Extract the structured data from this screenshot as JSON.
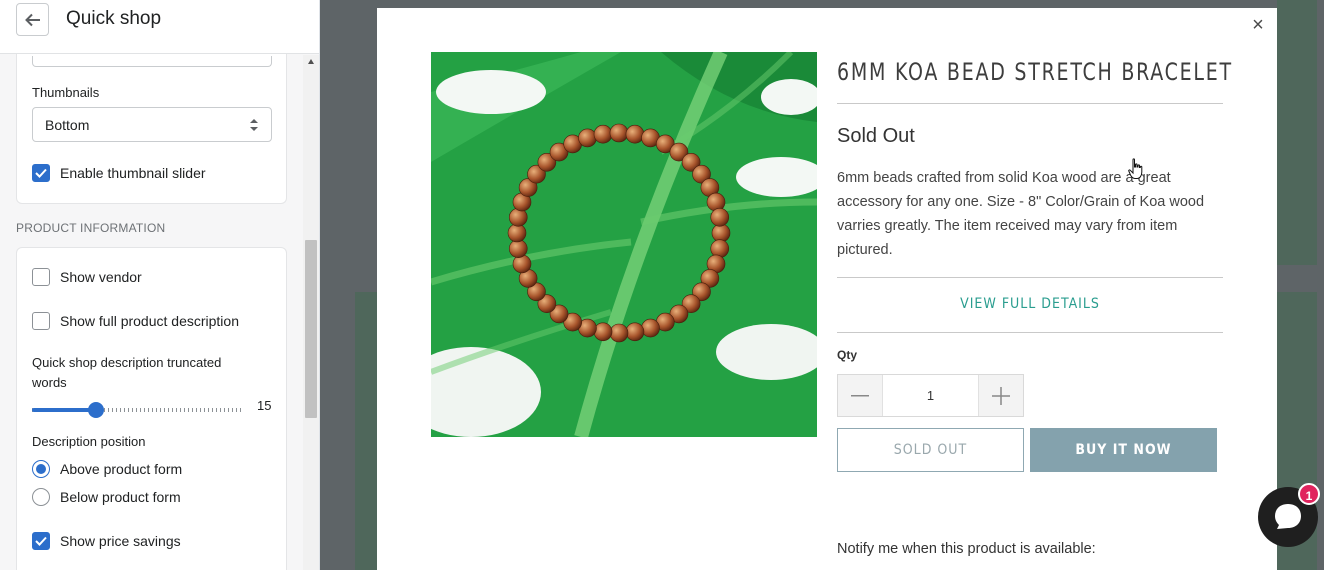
{
  "sidebar": {
    "title": "Quick shop",
    "thumbnails": {
      "label": "Thumbnails",
      "value": "Bottom"
    },
    "enable_thumb_slider": {
      "label": "Enable thumbnail slider",
      "checked": true
    },
    "section_title": "PRODUCT INFORMATION",
    "show_vendor": {
      "label": "Show vendor",
      "checked": false
    },
    "show_full_desc": {
      "label": "Show full product description",
      "checked": false
    },
    "truncated_words": {
      "label": "Quick shop description truncated words",
      "value": "15",
      "fraction": 0.3
    },
    "desc_position": {
      "label": "Description position",
      "options": [
        "Above product form",
        "Below product form"
      ],
      "selected": "Above product form"
    },
    "show_price_savings": {
      "label": "Show price savings",
      "checked": true
    }
  },
  "modal": {
    "product_title": "6MM KOA BEAD STRETCH BRACELET",
    "status": "Sold Out",
    "description": "6mm beads crafted from solid Koa wood are a great accessory for any one. Size - 8\" Color/Grain of Koa wood varries greatly. The item received may vary from item pictured.",
    "view_details": "VIEW FULL DETAILS",
    "qty_label": "Qty",
    "qty_value": "1",
    "sold_out_button": "SOLD OUT",
    "buy_now_button": "BUY IT NOW",
    "notify_text": "Notify me when this product is available:",
    "close": "×"
  },
  "chat": {
    "badge": "1"
  },
  "colors": {
    "accent": "#2c6ecb",
    "teal_link": "#2a9d8f",
    "buy_button": "#84a2ad",
    "badge": "#e0245e"
  }
}
